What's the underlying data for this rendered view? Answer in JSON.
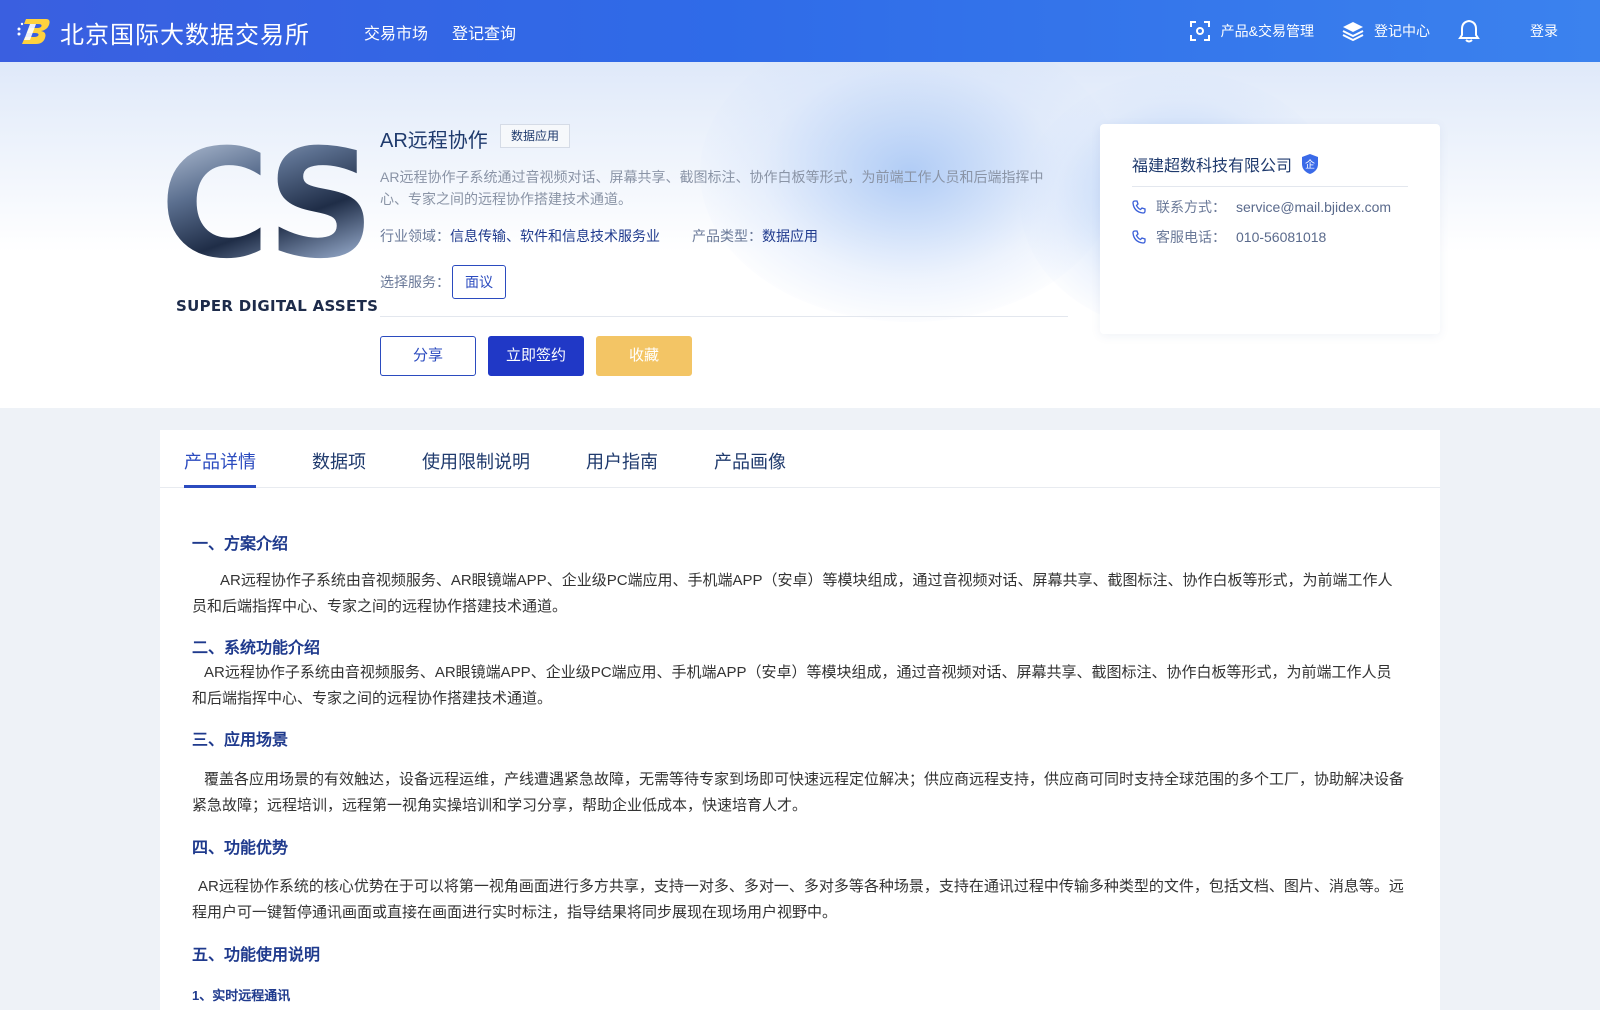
{
  "header": {
    "site_title": "北京国际大数据交易所",
    "nav": [
      "交易市场",
      "登记查询"
    ],
    "product_mgmt": "产品&交易管理",
    "register_center": "登记中心",
    "login": "登录"
  },
  "product": {
    "logo_text": "CS",
    "logo_subtitle": "SUPER DIGITAL ASSETS",
    "title": "AR远程协作",
    "badge": "数据应用",
    "description": "AR远程协作子系统通过音视频对话、屏幕共享、截图标注、协作白板等形式，为前端工作人员和后端指挥中心、专家之间的远程协作搭建技术通道。",
    "industry_label": "行业领域：",
    "industry_value": "信息传输、软件和信息技术服务业",
    "type_label": "产品类型：",
    "type_value": "数据应用",
    "service_label": "选择服务：",
    "service_option": "面议",
    "share": "分享",
    "sign": "立即签约",
    "favorite": "收藏"
  },
  "company": {
    "name": "福建超数科技有限公司",
    "badge": "企",
    "contact_label": "联系方式：",
    "contact_value": "service@mail.bjidex.com",
    "phone_label": "客服电话：",
    "phone_value": "010-56081018"
  },
  "tabs": [
    "产品详情",
    "数据项",
    "使用限制说明",
    "用户指南",
    "产品画像"
  ],
  "details": {
    "s1_title": "一、方案介绍",
    "s1_text": "AR远程协作子系统由音视频服务、AR眼镜端APP、企业级PC端应用、手机端APP（安卓）等模块组成，通过音视频对话、屏幕共享、截图标注、协作白板等形式，为前端工作人员和后端指挥中心、专家之间的远程协作搭建技术通道。",
    "s2_title": "二、系统功能介绍",
    "s2_text": "AR远程协作子系统由音视频服务、AR眼镜端APP、企业级PC端应用、手机端APP（安卓）等模块组成，通过音视频对话、屏幕共享、截图标注、协作白板等形式，为前端工作人员和后端指挥中心、专家之间的远程协作搭建技术通道。",
    "s3_title": "三、应用场景",
    "s3_text": "覆盖各应用场景的有效触达，设备远程运维，产线遭遇紧急故障，无需等待专家到场即可快速远程定位解决；供应商远程支持，供应商可同时支持全球范围的多个工厂，协助解决设备紧急故障；远程培训，远程第一视角实操培训和学习分享，帮助企业低成本，快速培育人才。",
    "s4_title": "四、功能优势",
    "s4_text": "AR远程协作系统的核心优势在于可以将第一视角画面进行多方共享，支持一对多、多对一、多对多等各种场景，支持在通讯过程中传输多种类型的文件，包括文档、图片、消息等。远程用户可一键暂停通讯画面或直接在画面进行实时标注，指导结果将同步展现在现场用户视野中。",
    "s5_title": "五、功能使用说明",
    "s5_sub1": "1、实时远程通讯"
  },
  "colors": {
    "header_start": "#3a5fe0",
    "header_end": "#3b82ee",
    "accent": "#2b4bbf",
    "primary_btn": "#2038c6",
    "favorite_btn": "#f3c565"
  }
}
